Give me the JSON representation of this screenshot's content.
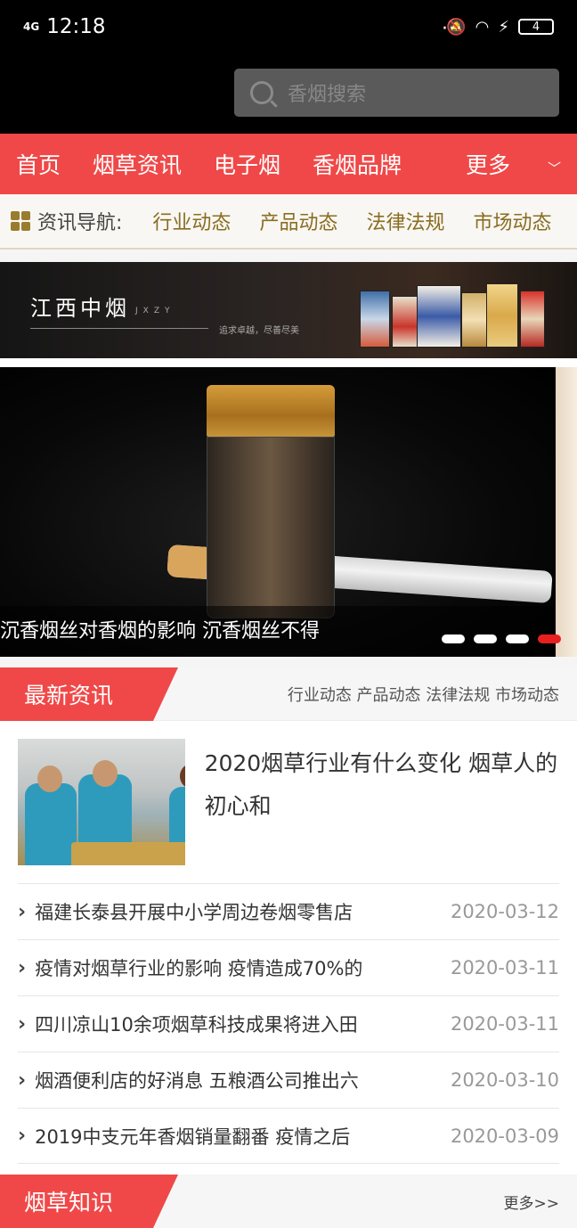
{
  "status_bar": {
    "network": "4G",
    "time": "12:18",
    "dots": "···",
    "battery": "4"
  },
  "search": {
    "placeholder": "香烟搜索"
  },
  "main_nav": {
    "items": [
      "首页",
      "烟草资讯",
      "电子烟",
      "香烟品牌"
    ],
    "more": "更多",
    "more_chevron": "﹀"
  },
  "sub_nav": {
    "label": "资讯导航:",
    "items": [
      "行业动态",
      "产品动态",
      "法律法规",
      "市场动态"
    ]
  },
  "banner": {
    "title": "江西中烟",
    "subtitle_en": "JXZY",
    "slogan": "追求卓越，尽善尽美"
  },
  "slider": {
    "caption": "沉香烟丝对香烟的影响 沉香烟丝不得",
    "slide_count": 4,
    "active_index": 3
  },
  "latest_news": {
    "title": "最新资讯",
    "links": "行业动态 产品动态 法律法规 市场动态",
    "featured_title": "2020烟草行业有什么变化 烟草人的初心和",
    "items": [
      {
        "title": "福建长泰县开展中小学周边卷烟零售店",
        "date": "2020-03-12"
      },
      {
        "title": "疫情对烟草行业的影响 疫情造成70%的",
        "date": "2020-03-11"
      },
      {
        "title": "四川凉山10余项烟草科技成果将进入田",
        "date": "2020-03-11"
      },
      {
        "title": "烟酒便利店的好消息 五粮酒公司推出六",
        "date": "2020-03-10"
      },
      {
        "title": "2019中支元年香烟销量翻番 疫情之后",
        "date": "2020-03-09"
      }
    ]
  },
  "tobacco_knowledge": {
    "title": "烟草知识",
    "more": "更多>>"
  },
  "colors": {
    "accent_red": "#f04848",
    "nav_gold": "#8a6d21",
    "date_gray": "#999999"
  }
}
